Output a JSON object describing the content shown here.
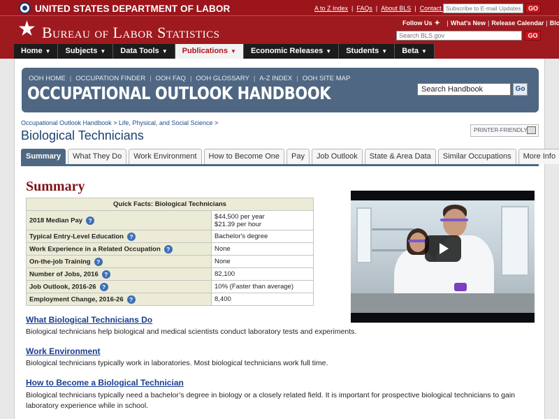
{
  "dol": {
    "name": "UNITED STATES DEPARTMENT OF LABOR",
    "utility_links": [
      "A to Z Index",
      "FAQs",
      "About BLS",
      "Contact Us"
    ],
    "email_placeholder": "Subscribe to E-mail Updates",
    "go_label": "GO"
  },
  "bls": {
    "name": "Bureau of Labor Statistics",
    "follow_label": "Follow Us",
    "follow_links": [
      "What's New",
      "Release Calendar",
      "Blog"
    ],
    "search_placeholder": "Search BLS.gov"
  },
  "nav": {
    "items": [
      "Home",
      "Subjects",
      "Data Tools",
      "Publications",
      "Economic Releases",
      "Students",
      "Beta"
    ],
    "active": "Publications"
  },
  "ooh": {
    "links": [
      "OOH HOME",
      "OCCUPATION FINDER",
      "OOH FAQ",
      "OOH GLOSSARY",
      "A-Z INDEX",
      "OOH SITE MAP"
    ],
    "title": "OCCUPATIONAL OUTLOOK HANDBOOK",
    "search_value": "Search Handbook",
    "go_label": "Go"
  },
  "breadcrumb": {
    "items": [
      "Occupational Outlook Handbook",
      "Life, Physical, and Social Science"
    ],
    "separator": ">"
  },
  "page_title": "Biological Technicians",
  "printer_friendly": "PRINTER-FRIENDLY",
  "tabs": {
    "items": [
      "Summary",
      "What They Do",
      "Work Environment",
      "How to Become One",
      "Pay",
      "Job Outlook",
      "State & Area Data",
      "Similar Occupations",
      "More Info"
    ],
    "active": "Summary"
  },
  "summary": {
    "heading": "Summary",
    "quick_facts": {
      "title": "Quick Facts: Biological Technicians",
      "rows": [
        {
          "label": "2018 Median Pay",
          "value": "$44,500 per year",
          "value2": "$21.39 per hour"
        },
        {
          "label": "Typical Entry-Level Education",
          "value": "Bachelor's degree"
        },
        {
          "label": "Work Experience in a Related Occupation",
          "value": "None"
        },
        {
          "label": "On-the-job Training",
          "value": "None"
        },
        {
          "label": "Number of Jobs, 2016",
          "value": "82,100"
        },
        {
          "label": "Job Outlook, 2016-26",
          "value": "10% (Faster than average)"
        },
        {
          "label": "Employment Change, 2016-26",
          "value": "8,400"
        }
      ]
    },
    "help_glyph": "?",
    "sections": [
      {
        "heading": "What Biological Technicians Do",
        "text": "Biological technicians help biological and medical scientists conduct laboratory tests and experiments."
      },
      {
        "heading": "Work Environment",
        "text": "Biological technicians typically work in laboratories. Most biological technicians work full time."
      },
      {
        "heading": "How to Become a Biological Technician",
        "text": "Biological technicians typically need a bachelor’s degree in biology or a closely related field. It is important for prospective biological technicians to gain laboratory experience while in school."
      }
    ]
  },
  "icons": {
    "star": "★",
    "twitter": "✦",
    "caret": "▼"
  },
  "colors": {
    "brand_red": "#9e1a1f",
    "ooh_blue": "#4f6782",
    "heading_red": "#7d1518",
    "link_blue": "#1a3e91"
  }
}
